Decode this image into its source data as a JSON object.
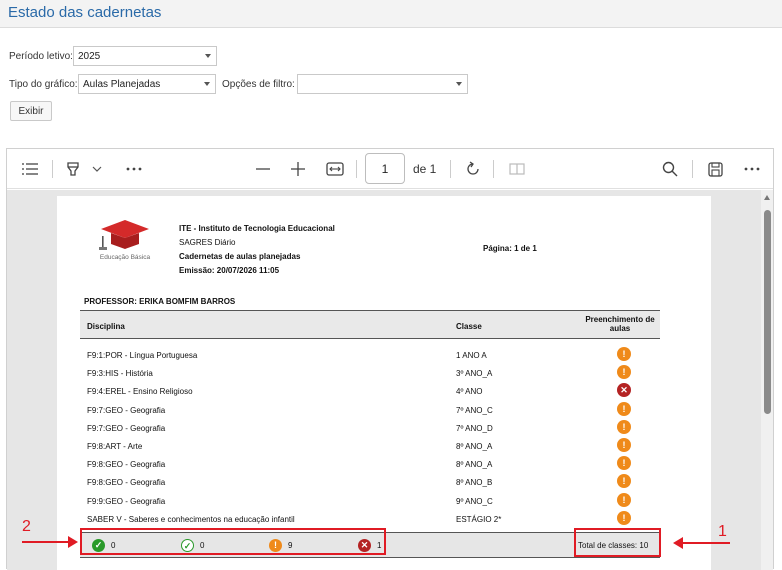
{
  "page_title": "Estado das cadernetas",
  "form": {
    "periodo_label": "Período letivo:",
    "periodo_value": "2025",
    "tipo_label": "Tipo do gráfico:",
    "tipo_value": "Aulas Planejadas",
    "filtro_label": "Opções de filtro:",
    "filtro_value": "",
    "exibir_label": "Exibir"
  },
  "viewer": {
    "page_input": "1",
    "page_total": "de 1"
  },
  "report": {
    "logo_text": "Educação Básica",
    "institution": "ITE - Instituto de Tecnologia Educacional",
    "system": "SAGRES Diário",
    "report_name": "Cadernetas de aulas planejadas",
    "emission": "Emissão: 20/07/2026 11:05",
    "page_info": "Página: 1 de 1",
    "professor": "PROFESSOR:  ERIKA BOMFIM BARROS",
    "col_disciplina": "Disciplina",
    "col_classe": "Classe",
    "col_preenchimento": "Preenchimento de aulas",
    "rows": [
      {
        "disciplina": "F9:1:POR - Língua Portuguesa",
        "classe": "1 ANO A",
        "status": "warning"
      },
      {
        "disciplina": "F9:3:HIS - História",
        "classe": "3º ANO_A",
        "status": "warning"
      },
      {
        "disciplina": "F9:4:EREL - Ensino Religioso",
        "classe": "4º ANO",
        "status": "error"
      },
      {
        "disciplina": "F9:7:GEO - Geografia",
        "classe": "7º ANO_C",
        "status": "warning"
      },
      {
        "disciplina": "F9:7:GEO - Geografia",
        "classe": "7º ANO_D",
        "status": "warning"
      },
      {
        "disciplina": "F9:8:ART - Arte",
        "classe": "8º ANO_A",
        "status": "warning"
      },
      {
        "disciplina": "F9:8:GEO - Geografia",
        "classe": "8º ANO_A",
        "status": "warning"
      },
      {
        "disciplina": "F9:8:GEO - Geografia",
        "classe": "8º ANO_B",
        "status": "warning"
      },
      {
        "disciplina": "F9:9:GEO - Geografia",
        "classe": "9º ANO_C",
        "status": "warning"
      },
      {
        "disciplina": "SABER V - Saberes e conhecimentos na educação infantil",
        "classe": "ESTÁGIO 2*",
        "status": "warning"
      }
    ],
    "summary": {
      "complete_count": "0",
      "partial_count": "0",
      "warning_count": "9",
      "error_count": "1",
      "total_label": "Total de classes: 10"
    }
  },
  "annotations": {
    "label_1": "1",
    "label_2": "2"
  },
  "colors": {
    "title": "#2a6aa8",
    "warning": "#ef8a1a",
    "error": "#b42323",
    "ok": "#2a9a2a",
    "annotation": "#e01b24"
  }
}
